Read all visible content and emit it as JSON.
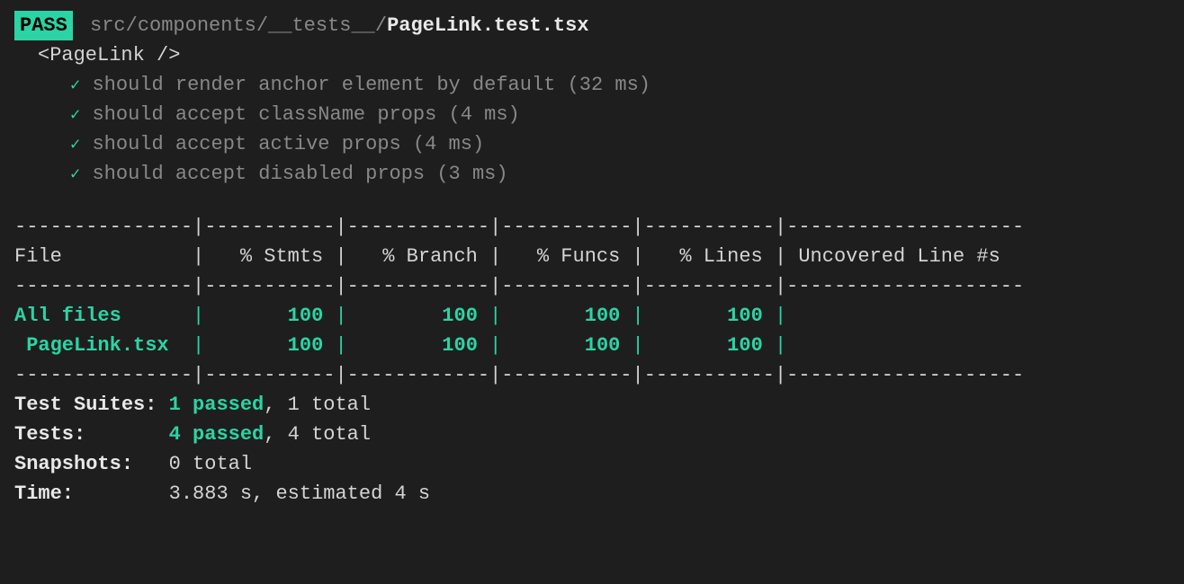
{
  "header": {
    "badge": "PASS",
    "path_prefix": "src/components/__tests__/",
    "filename": "PageLink.test.tsx"
  },
  "suite": {
    "name": "<PageLink />",
    "tests": [
      {
        "name": "should render anchor element by default",
        "ms": "(32 ms)"
      },
      {
        "name": "should accept className props",
        "ms": "(4 ms)"
      },
      {
        "name": "should accept active props",
        "ms": "(4 ms)"
      },
      {
        "name": "should accept disabled props",
        "ms": "(3 ms)"
      }
    ]
  },
  "coverage": {
    "headers": {
      "file": "File",
      "stmts": "% Stmts",
      "branch": "% Branch",
      "funcs": "% Funcs",
      "lines": "% Lines",
      "uncovered": "Uncovered Line #s"
    },
    "rows": [
      {
        "file": "All files",
        "indent": "",
        "stmts": "100",
        "branch": "100",
        "funcs": "100",
        "lines": "100",
        "uncovered": ""
      },
      {
        "file": "PageLink.tsx",
        "indent": " ",
        "stmts": "100",
        "branch": "100",
        "funcs": "100",
        "lines": "100",
        "uncovered": ""
      }
    ]
  },
  "summary": {
    "suites_label": "Test Suites:",
    "suites_passed": "1 passed",
    "suites_total": ", 1 total",
    "tests_label": "Tests:",
    "tests_passed": "4 passed",
    "tests_total": ", 4 total",
    "snapshots_label": "Snapshots:",
    "snapshots_value": "0 total",
    "time_label": "Time:",
    "time_value": "3.883 s, estimated 4 s"
  }
}
